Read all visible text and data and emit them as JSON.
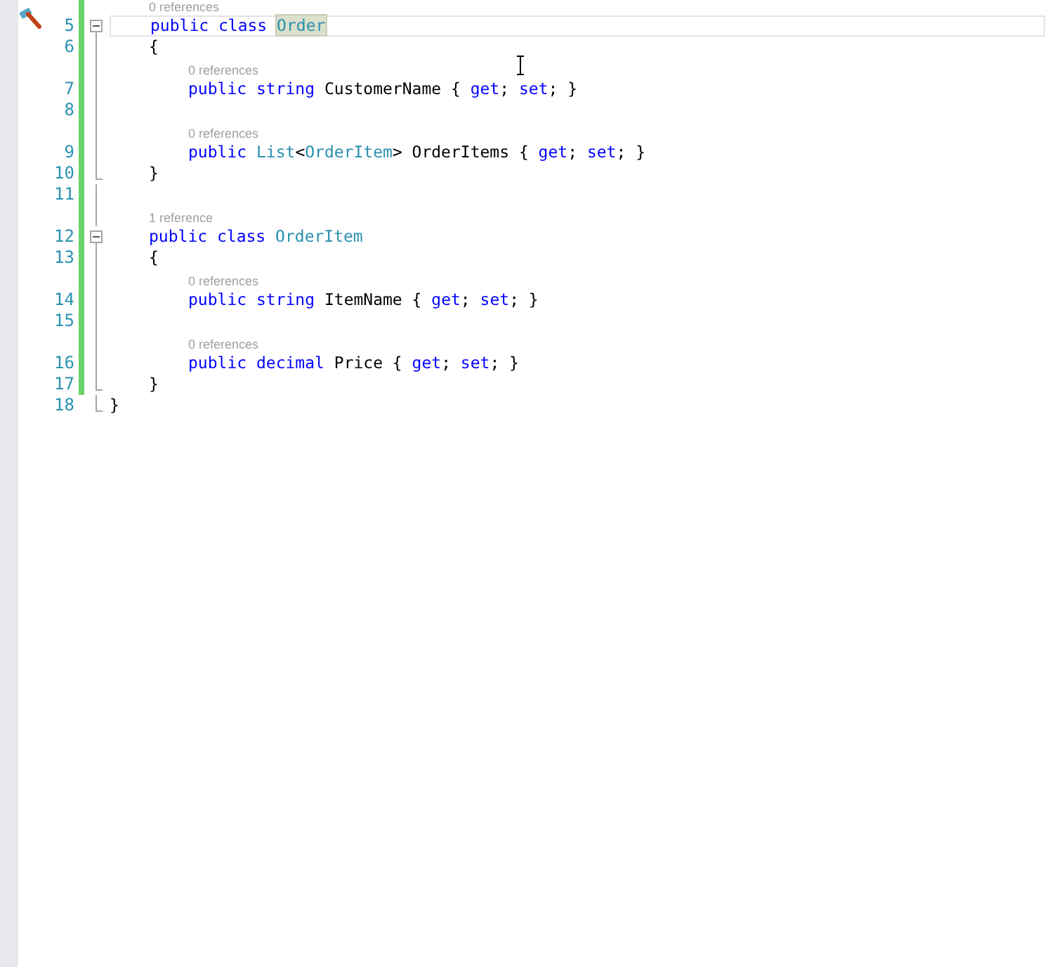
{
  "blocks": [
    {
      "kind": "block",
      "children": [
        {
          "kind": "block",
          "lens": "0 references",
          "number": "5",
          "changed": true,
          "current": true,
          "expanded": true,
          "tokens": [
            {
              "kind": "keyword",
              "text": "public"
            },
            {
              "kind": "keyword",
              "text": "class"
            },
            {
              "kind": "type",
              "text": "Order",
              "highlighted": true
            }
          ],
          "open": {
            "number": "6",
            "changed": true,
            "tokens": [
              {
                "kind": "plain",
                "text": "{"
              }
            ]
          },
          "children": [
            {
              "kind": "line",
              "lens": "0 references",
              "number": "7",
              "changed": true,
              "tokens": [
                {
                  "kind": "keyword",
                  "text": "public"
                },
                {
                  "kind": "keyword",
                  "text": "string"
                },
                {
                  "kind": "plain",
                  "text": "CustomerName { "
                },
                {
                  "kind": "keyword",
                  "text": "get"
                },
                {
                  "kind": "plain",
                  "text": "; "
                },
                {
                  "kind": "keyword",
                  "text": "set"
                },
                {
                  "kind": "plain",
                  "text": "; }"
                }
              ]
            },
            {
              "kind": "line",
              "number": "8",
              "changed": true
            },
            {
              "kind": "line",
              "lens": "0 references",
              "number": "9",
              "changed": true,
              "tokens": [
                {
                  "kind": "keyword",
                  "text": "public"
                },
                {
                  "kind": "type",
                  "text": "List"
                },
                {
                  "kind": "plain",
                  "text": "<"
                },
                {
                  "kind": "type",
                  "text": "OrderItem"
                },
                {
                  "kind": "plain",
                  "text": "> OrderItems { "
                },
                {
                  "kind": "keyword",
                  "text": "get"
                },
                {
                  "kind": "plain",
                  "text": "; "
                },
                {
                  "kind": "keyword",
                  "text": "set"
                },
                {
                  "kind": "plain",
                  "text": "; }"
                }
              ]
            }
          ],
          "close": {
            "number": "10",
            "changed": true,
            "tokens": [
              {
                "kind": "plain",
                "text": "}"
              }
            ]
          }
        },
        {
          "kind": "line",
          "number": "11",
          "changed": true
        },
        {
          "kind": "block",
          "lens": "1 reference",
          "number": "12",
          "changed": true,
          "expanded": true,
          "tokens": [
            {
              "kind": "keyword",
              "text": "public"
            },
            {
              "kind": "keyword",
              "text": "class"
            },
            {
              "kind": "type",
              "text": "OrderItem"
            }
          ],
          "open": {
            "number": "13",
            "changed": true,
            "tokens": [
              {
                "kind": "plain",
                "text": "{"
              }
            ]
          },
          "children": [
            {
              "kind": "line",
              "lens": "0 references",
              "number": "14",
              "changed": true,
              "tokens": [
                {
                  "kind": "keyword",
                  "text": "public"
                },
                {
                  "kind": "keyword",
                  "text": "string"
                },
                {
                  "kind": "plain",
                  "text": "ItemName { "
                },
                {
                  "kind": "keyword",
                  "text": "get"
                },
                {
                  "kind": "plain",
                  "text": "; "
                },
                {
                  "kind": "keyword",
                  "text": "set"
                },
                {
                  "kind": "plain",
                  "text": "; }"
                }
              ]
            },
            {
              "kind": "line",
              "number": "15",
              "changed": true
            },
            {
              "kind": "line",
              "lens": "0 references",
              "number": "16",
              "changed": true,
              "tokens": [
                {
                  "kind": "keyword",
                  "text": "public"
                },
                {
                  "kind": "keyword",
                  "text": "decimal"
                },
                {
                  "kind": "plain",
                  "text": "Price { "
                },
                {
                  "kind": "keyword",
                  "text": "get"
                },
                {
                  "kind": "plain",
                  "text": "; "
                },
                {
                  "kind": "keyword",
                  "text": "set"
                },
                {
                  "kind": "plain",
                  "text": "; }"
                }
              ]
            }
          ],
          "close": {
            "number": "17",
            "changed": true,
            "tokens": [
              {
                "kind": "plain",
                "text": "}"
              }
            ]
          }
        }
      ],
      "close": {
        "number": "18",
        "changed": false,
        "tokens": [
          {
            "kind": "plain",
            "text": "}"
          }
        ]
      }
    }
  ]
}
